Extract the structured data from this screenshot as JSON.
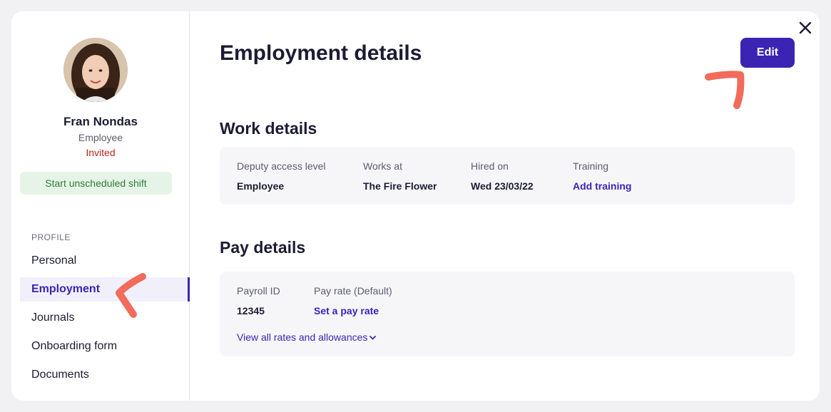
{
  "employee": {
    "name": "Fran Nondas",
    "role": "Employee",
    "status": "Invited"
  },
  "actions": {
    "start_shift": "Start unscheduled shift",
    "edit": "Edit"
  },
  "sidebar": {
    "section_label": "PROFILE",
    "items": [
      {
        "label": "Personal"
      },
      {
        "label": "Employment"
      },
      {
        "label": "Journals"
      },
      {
        "label": "Onboarding form"
      },
      {
        "label": "Documents"
      }
    ],
    "active_item": "Employment"
  },
  "page": {
    "title": "Employment details"
  },
  "work_details": {
    "heading": "Work details",
    "fields": [
      {
        "label": "Deputy access level",
        "value": "Employee"
      },
      {
        "label": "Works at",
        "value": "The Fire Flower"
      },
      {
        "label": "Hired on",
        "value": "Wed 23/03/22"
      },
      {
        "label": "Training",
        "value": "Add training"
      }
    ]
  },
  "pay_details": {
    "heading": "Pay details",
    "fields": [
      {
        "label": "Payroll ID",
        "value": "12345"
      },
      {
        "label": "Pay rate (Default)",
        "value": "Set a pay rate"
      }
    ],
    "rates_link": "View all rates and allowances"
  },
  "icons": {
    "close": "close-icon",
    "chevron": "chevron-down-icon"
  },
  "colors": {
    "accent": "#3b24b3",
    "success_bg": "#e6f4e8",
    "success_text": "#2e7d32",
    "status_invited": "#b3261e",
    "annotation": "#f26b5b"
  }
}
